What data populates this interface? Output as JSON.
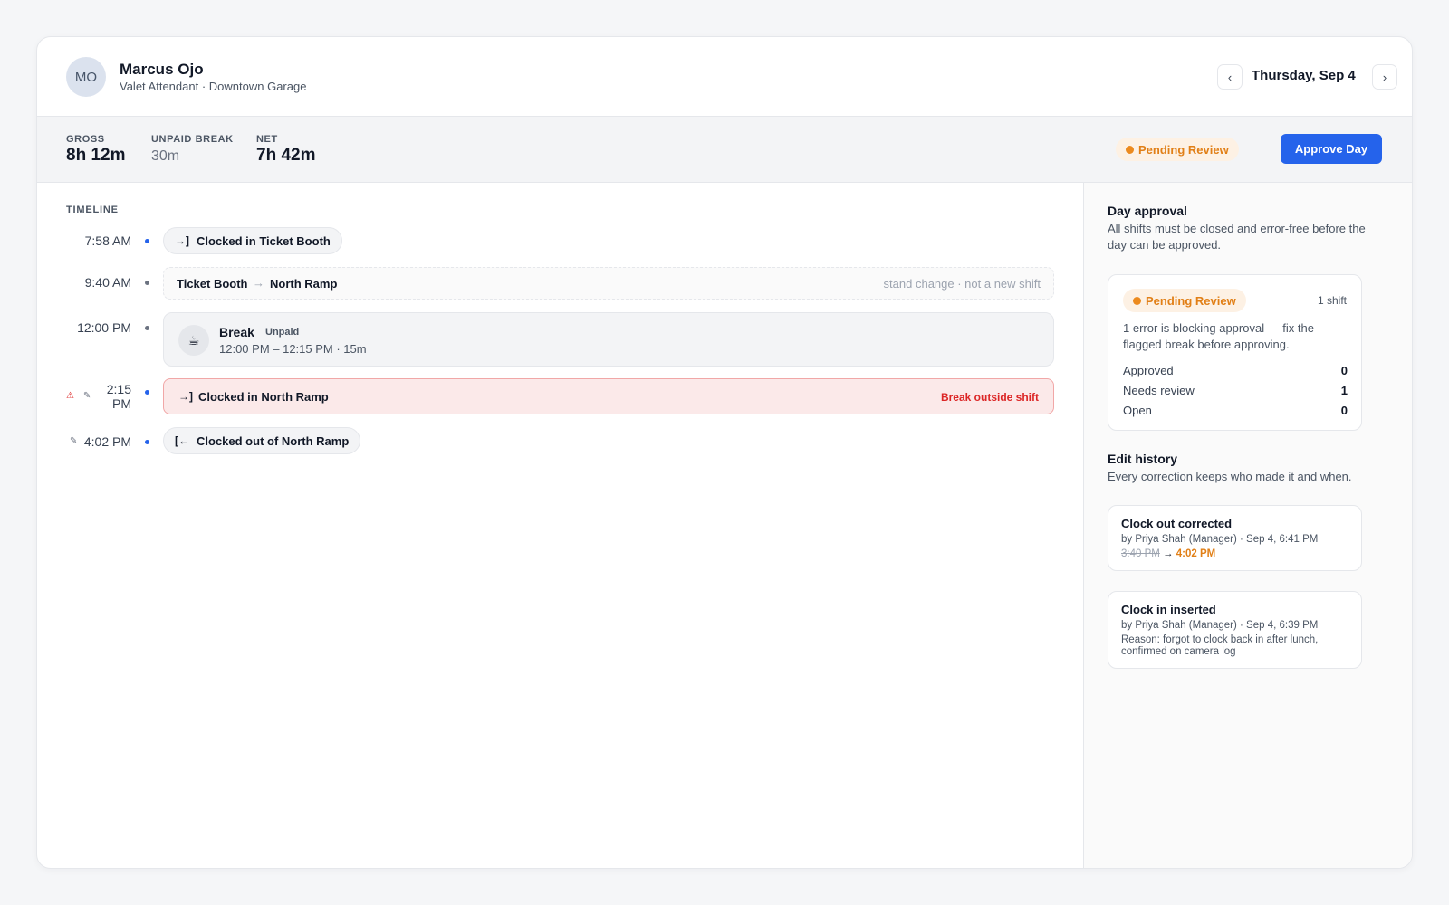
{
  "employee": {
    "initials": "MO",
    "name": "Marcus Ojo",
    "role": "Valet Attendant · Downtown Garage"
  },
  "date_nav": {
    "prev": "‹",
    "label": "Thursday, Sep 4",
    "next": "›"
  },
  "summary": {
    "gross_label": "GROSS",
    "gross_value": "8h 12m",
    "break_label": "UNPAID BREAK",
    "break_value": "30m",
    "net_label": "NET",
    "net_value": "7h 42m",
    "status": "Pending Review",
    "approve_label": "Approve Day"
  },
  "timeline": {
    "title": "TIMELINE",
    "clock_in_1": {
      "time": "7:58 AM",
      "icon": "→]",
      "label": "Clocked in Ticket Booth"
    },
    "stand_change": {
      "time": "9:40 AM",
      "from": "Ticket Booth",
      "arrow": "→",
      "to": "North Ramp",
      "note": "stand change · not a new shift"
    },
    "break": {
      "time": "12:00 PM",
      "icon": "☕",
      "title": "Break",
      "tag": "Unpaid",
      "range": "12:00 PM – 12:15 PM · 15m"
    },
    "clock_in_2": {
      "time_line1": "2:15",
      "time_line2": "PM",
      "warning_icon": "⚠",
      "edit_icon": "✎",
      "icon": "→]",
      "label": "Clocked in North Ramp",
      "flag": "Break outside shift"
    },
    "clock_out": {
      "time": "4:02 PM",
      "edit_icon": "✎",
      "icon": "[←",
      "label": "Clocked out of North Ramp"
    }
  },
  "day_approval": {
    "title": "Day approval",
    "description": "All shifts must be closed and error-free before the day can be approved.",
    "status": "Pending Review",
    "shift_count": "1 shift",
    "blocking": "1 error is blocking approval — fix the flagged break before approving.",
    "counts": [
      {
        "label": "Approved",
        "value": "0"
      },
      {
        "label": "Needs review",
        "value": "1"
      },
      {
        "label": "Open",
        "value": "0"
      }
    ]
  },
  "edit_history": {
    "title": "Edit history",
    "description": "Every correction keeps who made it and when.",
    "entries": [
      {
        "title": "Clock out corrected",
        "by": "by Priya Shah (Manager) · Sep 4, 6:41 PM",
        "old": "3:40 PM",
        "arrow": "→",
        "new": "4:02 PM"
      },
      {
        "title": "Clock in inserted",
        "by": "by Priya Shah (Manager) · Sep 4, 6:39 PM",
        "reason": "Reason: forgot to clock back in after lunch, confirmed on camera log"
      }
    ]
  },
  "colors": {
    "accent": "#2563eb",
    "pending": "#e17f16",
    "error": "#dc2626"
  }
}
